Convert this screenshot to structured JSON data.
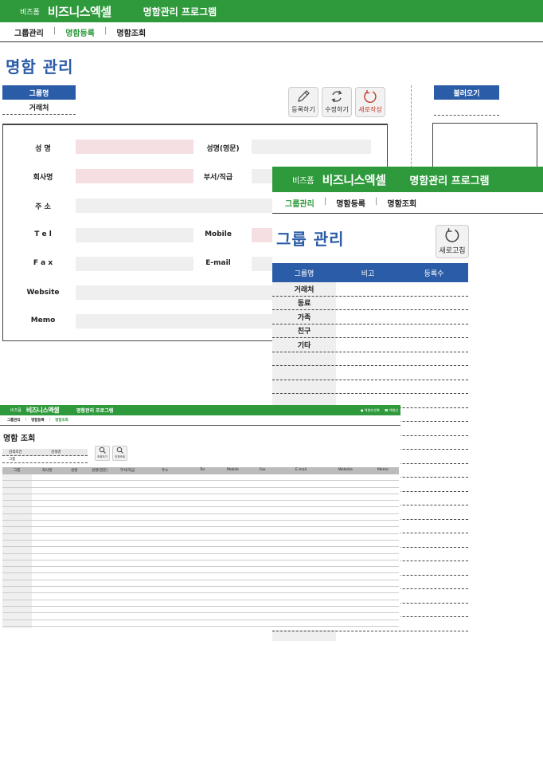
{
  "panel_card": {
    "brand_small": "비즈폼",
    "brand_big": "비즈니스엑셀",
    "app_title": "명함관리 프로그램",
    "nav": [
      "그룹관리",
      "명함등록",
      "명함조회"
    ],
    "page_title": "명함 관리",
    "group_label": "그룹명",
    "group_value": "거래처",
    "buttons": {
      "register": "등록하기",
      "edit": "수정하기",
      "new": "새로작성"
    },
    "load_label": "불러오기",
    "fields": {
      "name": "성 명",
      "name_en": "성명(영문)",
      "company": "회사명",
      "dept": "부서/직급",
      "address": "주 소",
      "tel": "T e l",
      "mobile": "Mobile",
      "fax": "F a x",
      "email": "E-mail",
      "website": "Website",
      "memo": "Memo"
    }
  },
  "panel_group": {
    "brand_small": "비즈폼",
    "brand_big": "비즈니스엑셀",
    "app_title": "명함관리 프로그램",
    "nav": [
      "그룹관리",
      "명함등록",
      "명함조회"
    ],
    "page_title": "그룹 관리",
    "refresh_label": "새로고침",
    "columns": [
      "그룹명",
      "비고",
      "등록수"
    ],
    "groups": [
      "거래처",
      "동료",
      "가족",
      "친구",
      "기타"
    ]
  },
  "panel_search": {
    "brand_small": "비즈폼",
    "brand_big": "비즈니스엑셀",
    "app_title": "명함관리 프로그램",
    "top_links": [
      "엑셀자식IN",
      "엑셀상"
    ],
    "nav": [
      "그룹관리",
      "명함등록",
      "명함조회"
    ],
    "page_title": "명함 조회",
    "cond_labels": [
      "검색조건",
      "검색명"
    ],
    "cond_value": "그룹",
    "btn_search": "조회하기",
    "btn_all": "전체조회",
    "columns": [
      "그룹",
      "회사명",
      "성명",
      "성명(영문)",
      "부서/직급",
      "주소",
      "Tel",
      "Mobile",
      "Fax",
      "E-mail",
      "Website",
      "Memo"
    ]
  }
}
